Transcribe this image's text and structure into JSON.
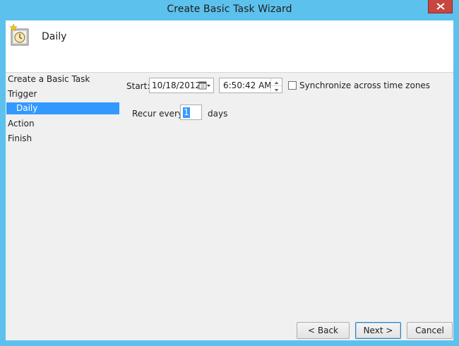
{
  "window": {
    "title": "Create Basic Task Wizard"
  },
  "header": {
    "title": "Daily",
    "icon": "calendar-clock-icon"
  },
  "steps": [
    {
      "label": "Create a Basic Task"
    },
    {
      "label": "Trigger"
    },
    {
      "label": "Daily",
      "selected": true
    },
    {
      "label": "Action"
    },
    {
      "label": "Finish"
    }
  ],
  "form": {
    "start_label": "Start:",
    "start_date": "10/18/2012",
    "start_time": "6:50:42 AM",
    "sync_label": "Synchronize across time zones",
    "sync_checked": false,
    "recur_label": "Recur every:",
    "recur_value": "1",
    "recur_unit": "days"
  },
  "buttons": {
    "back": "< Back",
    "next": "Next >",
    "cancel": "Cancel"
  },
  "colors": {
    "titlebar": "#5cc1ec",
    "close": "#c7463f",
    "selection": "#3399ff"
  }
}
